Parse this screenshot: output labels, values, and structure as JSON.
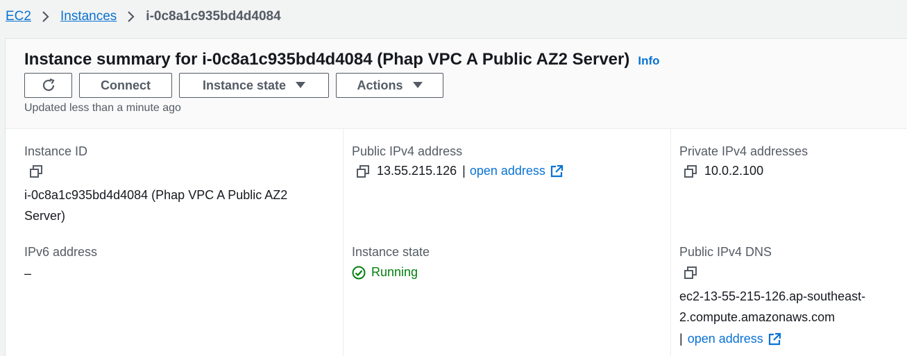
{
  "breadcrumb": {
    "items": [
      {
        "label": "EC2"
      },
      {
        "label": "Instances"
      }
    ],
    "current": "i-0c8a1c935bd4d4084"
  },
  "header": {
    "title": "Instance summary for i-0c8a1c935bd4d4084 (Phap VPC A Public AZ2 Server)",
    "info_label": "Info",
    "updated": "Updated less than a minute ago"
  },
  "toolbar": {
    "refresh_icon": "refresh-icon",
    "connect_label": "Connect",
    "instance_state_label": "Instance state",
    "actions_label": "Actions"
  },
  "details": {
    "instance_id": {
      "label": "Instance ID",
      "value_line1": "i-0c8a1c935bd4d4084 (Phap VPC A Public AZ2",
      "value_line2": "Server)"
    },
    "public_ipv4": {
      "label": "Public IPv4 address",
      "value": "13.55.215.126",
      "separator": "|",
      "link_label": "open address"
    },
    "private_ipv4": {
      "label": "Private IPv4 addresses",
      "value": "10.0.2.100"
    },
    "ipv6": {
      "label": "IPv6 address",
      "value": "–"
    },
    "instance_state": {
      "label": "Instance state",
      "value": "Running"
    },
    "public_dns": {
      "label": "Public IPv4 DNS",
      "value_line1": "ec2-13-55-215-126.ap-southeast-",
      "value_line2": "2.compute.amazonaws.com",
      "separator": "|",
      "link_label": "open address"
    }
  },
  "colors": {
    "link": "#0972d3",
    "text": "#16191f",
    "muted": "#545b64",
    "success": "#037f0c",
    "page_bg": "#f2f3f3",
    "panel_bg": "#ffffff"
  }
}
